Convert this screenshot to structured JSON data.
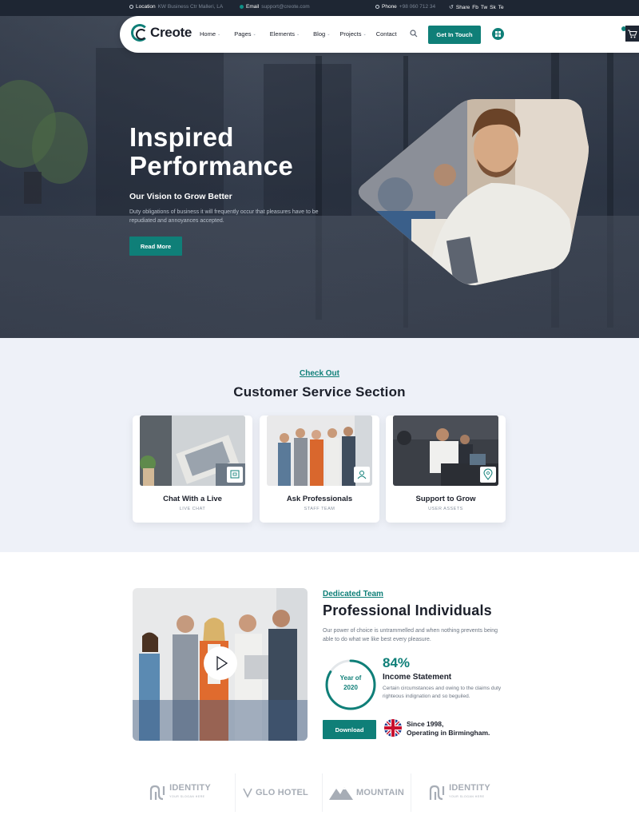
{
  "topbar": {
    "location_label": "Location",
    "location_value": "KW Business Ctr Malleri, LA",
    "email_label": "Email",
    "email_value": "support@creote.com",
    "phone_label": "Phone",
    "phone_value": "+98 060 712 34",
    "share_label": "Share",
    "social": [
      "Fb",
      "Tw",
      "Sk",
      "Te"
    ]
  },
  "nav": {
    "logo": "Creote",
    "items": [
      {
        "label": "Home",
        "dropdown": true
      },
      {
        "label": "Pages",
        "dropdown": true
      },
      {
        "label": "Elements",
        "dropdown": true
      },
      {
        "label": "Blog",
        "dropdown": true
      },
      {
        "label": "Projects",
        "dropdown": true
      },
      {
        "label": "Contact",
        "dropdown": false
      }
    ],
    "cta": "Get In Touch",
    "cart_count": "0"
  },
  "hero": {
    "title_line1": "Inspired",
    "title_line2": "Performance",
    "subtitle": "Our Vision to Grow Better",
    "description": "Duty obligations of business it will frequently occur that pleasures have to be repudiated and annoyances accepted.",
    "button": "Read More"
  },
  "services": {
    "eyebrow": "Check Out",
    "title": "Customer Service Section",
    "cards": [
      {
        "title": "Chat With a Live",
        "subtitle": "LIVE CHAT",
        "icon": "chat-icon"
      },
      {
        "title": "Ask Professionals",
        "subtitle": "STAFF TEAM",
        "icon": "user-icon"
      },
      {
        "title": "Support to Grow",
        "subtitle": "USER ASSETS",
        "icon": "location-pin-icon"
      }
    ]
  },
  "about": {
    "eyebrow": "Dedicated Team",
    "title": "Professional Individuals",
    "description": "Our power of choice is untrammelled and when nothing prevents being able to do what we like best every pleasure.",
    "ring_line1": "Year of",
    "ring_line2": "2020",
    "ring_fraction": 0.84,
    "percent": "84%",
    "income_title": "Income Statement",
    "income_desc": "Certain circumstances and owing to the claims duty righteous indignation and so beguiled.",
    "button": "Download",
    "since_line1": "Since 1998,",
    "since_line2": "Operating in Birmingham."
  },
  "brands": [
    {
      "name": "IDENTITY",
      "tag": "YOUR SLOGAN HERE",
      "icon": "identity-logo-icon"
    },
    {
      "name": "GLO HOTEL",
      "tag": "",
      "icon": "glo-hotel-logo-icon"
    },
    {
      "name": "MOUNTAIN",
      "tag": "",
      "icon": "mountain-logo-icon"
    },
    {
      "name": "IDENTITY",
      "tag": "YOUR SLOGAN HERE",
      "icon": "identity-logo-icon"
    }
  ],
  "colors": {
    "accent": "#0f7f78",
    "dark": "#1e2633",
    "section_bg": "#eef1f8"
  }
}
